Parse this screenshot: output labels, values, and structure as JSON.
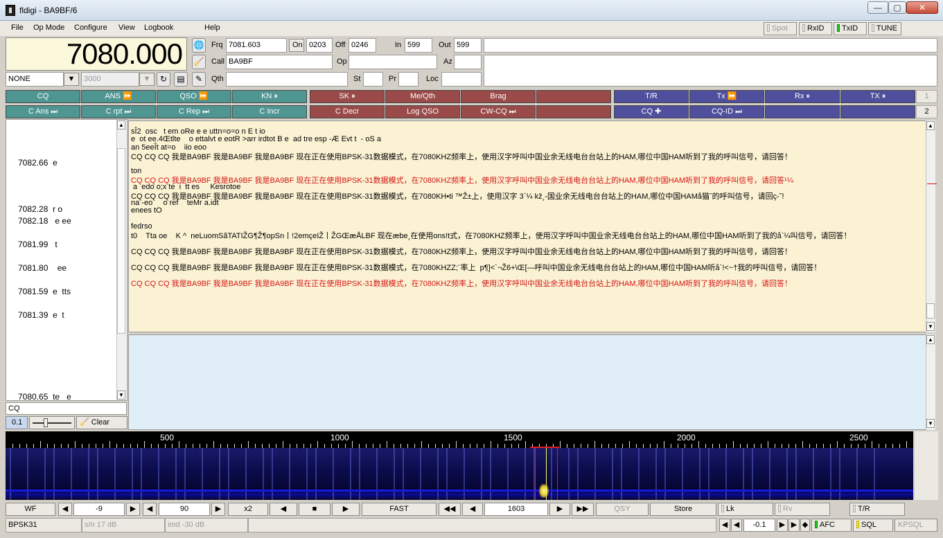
{
  "window": {
    "title": "fldigi - BA9BF/6",
    "min": "—",
    "max": "▢",
    "close": "✕"
  },
  "menu": {
    "file": "File",
    "opmode": "Op Mode",
    "configure": "Configure",
    "view": "View",
    "logbook": "Logbook",
    "help": "Help"
  },
  "toggles": {
    "spot": "Spot",
    "rxid": "RxID",
    "txid": "TxID",
    "tune": "TUNE"
  },
  "freq_display": "7080.000",
  "log": {
    "frq_label": "Frq",
    "frq": "7081.603",
    "on_label": "On",
    "on": "0203",
    "off_label": "Off",
    "off": "0246",
    "in_label": "In",
    "in": "599",
    "out_label": "Out",
    "out": "599",
    "call_label": "Call",
    "call": "BA9BF",
    "op_label": "Op",
    "op": "",
    "az_label": "Az",
    "az": "",
    "qth_label": "Qth",
    "qth": "",
    "st_label": "St",
    "st": "",
    "pr_label": "Pr",
    "pr": "",
    "loc_label": "Loc",
    "loc": ""
  },
  "mode_select": "NONE",
  "bw_select": "3000",
  "macros_row1": [
    "CQ",
    "ANS ⏩",
    "QSO ⏩",
    "KN ⏸",
    "SK ⏸",
    "Me/Qth",
    "Brag",
    "",
    "T/R",
    "Tx ⏩",
    "Rx ⏸",
    "TX ⏸"
  ],
  "macros_row2": [
    "C Ans ⏭",
    "C rpt ⏭",
    "C Rep ⏭",
    "C Incr",
    "C Decr",
    "Log QSO",
    "CW-CQ ⏭",
    "",
    "CQ ✚",
    "CQ-ID ⏭",
    "",
    ""
  ],
  "macro_sets": [
    "1",
    "2"
  ],
  "signal_browser": [
    {
      "f": "7082.66",
      "t": "e"
    },
    {
      "f": "7082.28",
      "t": "r o"
    },
    {
      "f": "7082.18",
      "t": " e ee"
    },
    {
      "f": "7081.99",
      "t": " t"
    },
    {
      "f": "7081.80",
      "t": "  ee"
    },
    {
      "f": "7081.59",
      "t": "e  tts"
    },
    {
      "f": "7081.39",
      "t": "e  t"
    },
    {
      "f": "7080.65",
      "t": "te   e"
    }
  ],
  "browser_filter": "CQ",
  "browser_ctrl": {
    "level": "0.1",
    "clear": "Clear"
  },
  "rx_lines": [
    {
      "text": "sÎ2  osc   t em oRe e e uttn=o=o n E t io",
      "red": false
    },
    {
      "text": "e  ot ee.4Œtlte    o ettalvt e eotR >arr irdtot B e  ad tre esp -Æ Evt t  - oS a",
      "red": false
    },
    {
      "text": "an 5eeÎt at=o    iio eoo",
      "red": false
    },
    {
      "text": "CQ CQ CQ 我是BA9BF 我是BA9BF 我是BA9BF 现在正在使用BPSK-31数据模式，在7080KHZ频率上，使用汉字呼叫中国业余无线电台台站上的HAM,哪位中国HAM听到了我的呼叫信号，请回答！",
      "red": false
    },
    {
      "text": "",
      "red": false
    },
    {
      "text": "ton",
      "red": false
    },
    {
      "text": "CQ CQ CQ 我是BA9BF 我是BA9BF 我是BA9BF 现在正在使用BPSK-31数据模式，在7080KHZ频率上，使用汉字呼叫中国业余无线电台台站上的HAM,哪位中国HAM听到了我的呼叫信号，请回答¹¼",
      "red": true
    },
    {
      "text": " a  edo o;x te  i  tt es     Kesrotoe",
      "red": false
    },
    {
      "text": "CQ CQ CQ 我是BA9BF 我是BA9BF 我是BA9BF 现在正在使用BPSK-31数据模式，在7080KH•ti ™Ž±上，使用汉字 3`¼ kž¸-国业余无线电台台站上的HAM,哪位中国HAMå猫ˆ的呼叫信号，请回ç-˜!",
      "red": false
    },
    {
      "text": "na -eo     o ref    teMr a.idt",
      "red": false
    },
    {
      "text": "enees tO",
      "red": false
    },
    {
      "text": "",
      "red": false
    },
    {
      "text": "fedrso",
      "red": false
    },
    {
      "text": "t0    Tta oe    K ^  neLuomSãTATIŽG¶Ž¶opSn丨!2emçeIŽ丨ŽGŒæÅLBF 现在æbe¸在使用ons!t式，在7080KHZ频率上，使用汉字呼叫中国业余无线电台台站上的HAM,哪位中国HAM听到了我的å`¼叫信号，请回答！",
      "red": false
    },
    {
      "text": "",
      "red": false
    },
    {
      "text": "CQ CQ CQ 我是BA9BF 我是BA9BF 我是BA9BF 现在正在使用BPSK-31数据模式，在7080KHZ频率上，使用汉字呼叫中国业余无线电台台站上的HAM,哪位中国HAM听到了我的呼叫信号，请回答！",
      "red": false
    },
    {
      "text": "",
      "red": false
    },
    {
      "text": "CQ CQ CQ 我是BA9BF 我是BA9BF 我是BA9BF 现在正在使用BPSK-31数据模式，在7080KHZZ;¨率上  p¶]<`¬Ž6+\\Œ[—呼叫中国业余无线电台台站上的HAM,哪位中国HAM听å`!<~†我的呼叫信号，请回答！",
      "red": false
    },
    {
      "text": "",
      "red": false
    },
    {
      "text": "CQ CQ CQ 我是BA9BF 我是BA9BF 我是BA9BF 现在正在使用BPSK-31数据模式，在7080KHZ频率上，使用汉字呼叫中国业余无线电台台站上的HAM,哪位中国HAM听到了我的呼叫信号，请回答！",
      "red": true
    }
  ],
  "scale_labels": [
    "500",
    "1000",
    "1500",
    "2000",
    "2500"
  ],
  "wf_controls": {
    "wf": "WF",
    "offset": "-9",
    "range": "90",
    "zoom": "x2",
    "speed": "FAST",
    "carrier": "1603",
    "qsy": "QSY",
    "store": "Store",
    "lk": "Lk",
    "rv": "Rv",
    "tr": "T/R"
  },
  "status": {
    "mode": "BPSK31",
    "sn": "s/n 17 dB",
    "imd": "imd -30 dB",
    "squelch": "-0.1",
    "afc": "AFC",
    "sql": "SQL",
    "kpsql": "KPSQL"
  }
}
